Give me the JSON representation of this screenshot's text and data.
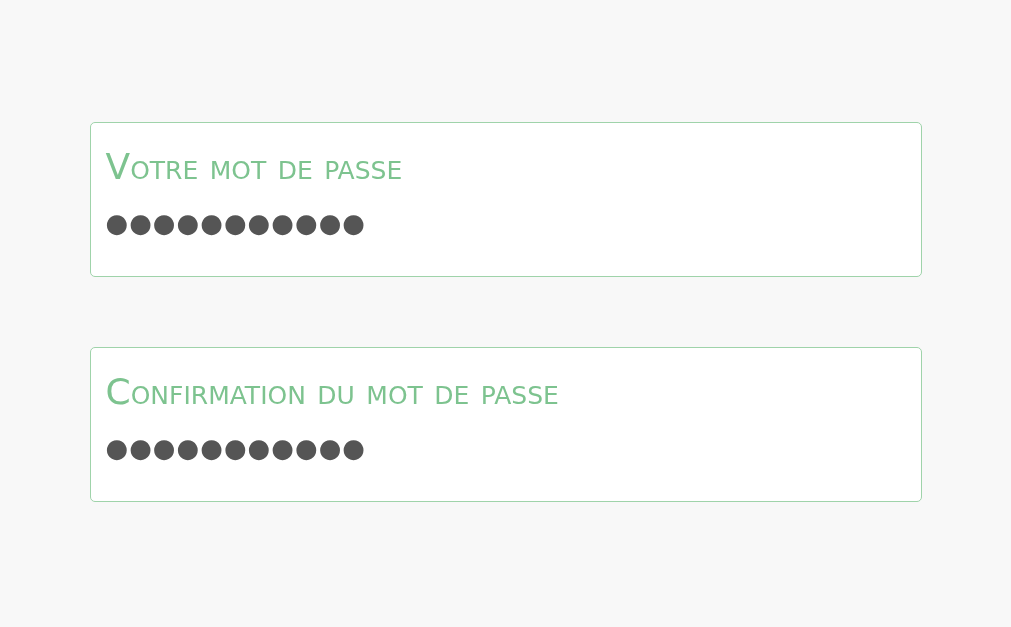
{
  "fields": [
    {
      "label": "Votre mot de passe",
      "value": "●●●●●●●●●●●"
    },
    {
      "label": "Confirmation du mot de passe",
      "value": "●●●●●●●●●●●"
    }
  ]
}
